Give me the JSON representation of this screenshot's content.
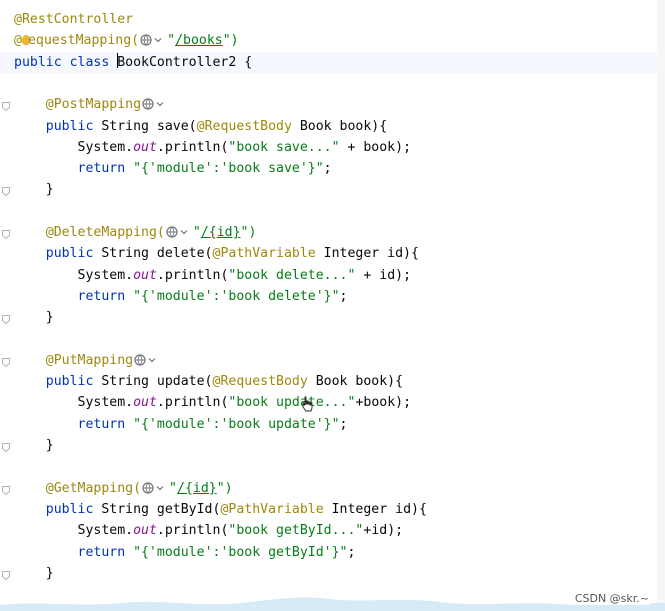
{
  "editor": {
    "lines": [
      {
        "segs": [
          {
            "t": "@RestController",
            "c": "ann"
          }
        ]
      },
      {
        "segs": [
          {
            "t": "@",
            "c": "ann"
          },
          {
            "t": "bulb"
          },
          {
            "t": "equestMapping(",
            "c": "ann"
          },
          {
            "t": "hint"
          },
          {
            "t": "\"",
            "c": "str"
          },
          {
            "t": "/books",
            "c": "str",
            "u": true
          },
          {
            "t": "\")",
            "c": "str"
          }
        ]
      },
      {
        "segs": [
          {
            "t": "public class ",
            "c": "kw"
          },
          {
            "t": "caret"
          },
          {
            "t": "BookController2 {"
          }
        ],
        "current": true
      },
      {
        "segs": []
      },
      {
        "segs": [
          {
            "t": "    @PostMapping",
            "c": "ann"
          },
          {
            "t": "hint"
          }
        ],
        "fold": true
      },
      {
        "segs": [
          {
            "t": "    "
          },
          {
            "t": "public ",
            "c": "kw"
          },
          {
            "t": "String "
          },
          {
            "t": "save(",
            "c": ""
          },
          {
            "t": "@RequestBody",
            "c": "ann"
          },
          {
            "t": " Book book){"
          }
        ]
      },
      {
        "segs": [
          {
            "t": "        System."
          },
          {
            "t": "out",
            "c": "fld"
          },
          {
            "t": ".println("
          },
          {
            "t": "\"book save...\"",
            "c": "str"
          },
          {
            "t": " + book);"
          }
        ]
      },
      {
        "segs": [
          {
            "t": "        "
          },
          {
            "t": "return ",
            "c": "kw"
          },
          {
            "t": "\"{'module':'book save'}\"",
            "c": "str"
          },
          {
            "t": ";"
          }
        ]
      },
      {
        "segs": [
          {
            "t": "    }"
          }
        ],
        "fold": true
      },
      {
        "segs": []
      },
      {
        "segs": [
          {
            "t": "    @DeleteMapping(",
            "c": "ann"
          },
          {
            "t": "hint"
          },
          {
            "t": "\"",
            "c": "str"
          },
          {
            "t": "/{id}",
            "c": "str",
            "u": true
          },
          {
            "t": "\")",
            "c": "str"
          }
        ],
        "fold": true
      },
      {
        "segs": [
          {
            "t": "    "
          },
          {
            "t": "public ",
            "c": "kw"
          },
          {
            "t": "String "
          },
          {
            "t": "delete("
          },
          {
            "t": "@PathVariable",
            "c": "ann"
          },
          {
            "t": " Integer id){"
          }
        ]
      },
      {
        "segs": [
          {
            "t": "        System."
          },
          {
            "t": "out",
            "c": "fld"
          },
          {
            "t": ".println("
          },
          {
            "t": "\"book delete...\"",
            "c": "str"
          },
          {
            "t": " + id);"
          }
        ]
      },
      {
        "segs": [
          {
            "t": "        "
          },
          {
            "t": "return ",
            "c": "kw"
          },
          {
            "t": "\"{'module':'book delete'}\"",
            "c": "str"
          },
          {
            "t": ";"
          }
        ]
      },
      {
        "segs": [
          {
            "t": "    }"
          }
        ],
        "fold": true
      },
      {
        "segs": []
      },
      {
        "segs": [
          {
            "t": "    @PutMapping",
            "c": "ann"
          },
          {
            "t": "hint"
          }
        ],
        "fold": true
      },
      {
        "segs": [
          {
            "t": "    "
          },
          {
            "t": "public ",
            "c": "kw"
          },
          {
            "t": "String "
          },
          {
            "t": "update("
          },
          {
            "t": "@RequestBody",
            "c": "ann"
          },
          {
            "t": " Book book){"
          }
        ]
      },
      {
        "segs": [
          {
            "t": "        System."
          },
          {
            "t": "out",
            "c": "fld"
          },
          {
            "t": ".println("
          },
          {
            "t": "\"book update...\"",
            "c": "str"
          },
          {
            "t": "+book);"
          }
        ]
      },
      {
        "segs": [
          {
            "t": "        "
          },
          {
            "t": "return ",
            "c": "kw"
          },
          {
            "t": "\"{'module':'book update'}\"",
            "c": "str"
          },
          {
            "t": ";"
          }
        ]
      },
      {
        "segs": [
          {
            "t": "    }"
          }
        ],
        "fold": true
      },
      {
        "segs": []
      },
      {
        "segs": [
          {
            "t": "    @GetMapping(",
            "c": "ann"
          },
          {
            "t": "hint"
          },
          {
            "t": "\"",
            "c": "str"
          },
          {
            "t": "/{id}",
            "c": "str",
            "u": true
          },
          {
            "t": "\")",
            "c": "str"
          }
        ],
        "fold": true
      },
      {
        "segs": [
          {
            "t": "    "
          },
          {
            "t": "public ",
            "c": "kw"
          },
          {
            "t": "String "
          },
          {
            "t": "getById("
          },
          {
            "t": "@PathVariable",
            "c": "ann"
          },
          {
            "t": " Integer id){"
          }
        ]
      },
      {
        "segs": [
          {
            "t": "        System."
          },
          {
            "t": "out",
            "c": "fld"
          },
          {
            "t": ".println("
          },
          {
            "t": "\"book getById...\"",
            "c": "str"
          },
          {
            "t": "+id);"
          }
        ]
      },
      {
        "segs": [
          {
            "t": "        "
          },
          {
            "t": "return ",
            "c": "kw"
          },
          {
            "t": "\"{'module':'book getById'}\"",
            "c": "str"
          },
          {
            "t": ";"
          }
        ]
      },
      {
        "segs": [
          {
            "t": "    }"
          }
        ],
        "fold": true
      }
    ]
  },
  "watermark": {
    "text": "CSDN @skr.~"
  },
  "colors": {
    "annotation": "#9e880d",
    "keyword": "#0033b3",
    "string": "#067d17",
    "field": "#871094"
  }
}
